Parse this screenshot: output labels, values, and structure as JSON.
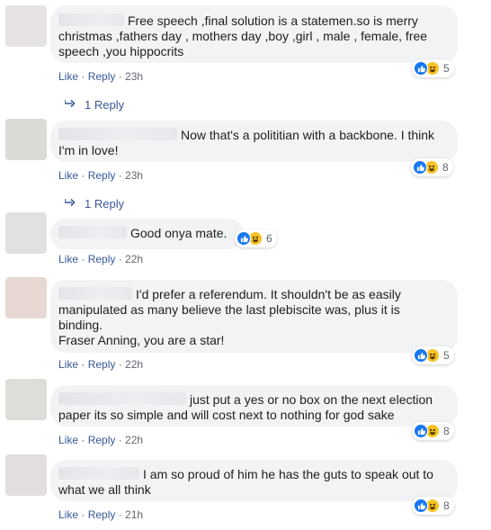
{
  "comments": [
    {
      "text": "Free speech ,final solution is a statemen.so is merry christmas ,fathers day , mothers day ,boy ,girl , male , female, free speech ,you hippocrits",
      "like": "Like",
      "reply": "Reply",
      "time": "23h",
      "reactions": "5",
      "replies": "1 Reply",
      "avatar_color": "#e6e2e3"
    },
    {
      "text": "Now that's a polititian with a backbone. I think I'm in love!",
      "like": "Like",
      "reply": "Reply",
      "time": "23h",
      "reactions": "8",
      "replies": "1 Reply",
      "avatar_color": "#d9dcd6"
    },
    {
      "text": "Good onya mate.",
      "like": "Like",
      "reply": "Reply",
      "time": "22h",
      "reactions": "6",
      "avatar_color": "#e1e1e3"
    },
    {
      "text": "I'd prefer a referendum. It shouldn't be as easily manipulated as many believe the last plebiscite was, plus it is binding.",
      "text2": "Fraser Anning, you are a star!",
      "like": "Like",
      "reply": "Reply",
      "time": "22h",
      "reactions": "5",
      "avatar_color": "#e8d8d4"
    },
    {
      "text": "just put a yes or no box on the next election paper its so simple and will cost next to nothing for god sake",
      "like": "Like",
      "reply": "Reply",
      "time": "22h",
      "reactions": "8",
      "avatar_color": "#dcdfd7"
    },
    {
      "text": "I am so proud of him he has the guts to speak out to what we all think",
      "like": "Like",
      "reply": "Reply",
      "time": "21h",
      "reactions": "8",
      "avatar_color": "#e2dde0"
    }
  ],
  "icons": {
    "like": "like-thumb-icon",
    "haha": "haha-face-icon",
    "reply_arrow": "reply-arrow-icon"
  },
  "colors": {
    "link": "#385898",
    "bubble": "#f2f3f5",
    "like_blue": "#1877f2",
    "haha_yellow": "#f7c325"
  }
}
